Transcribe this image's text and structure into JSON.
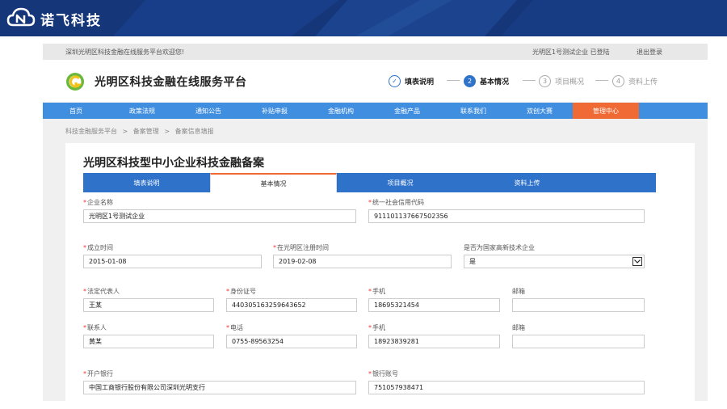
{
  "brand": {
    "name": "诺飞科技"
  },
  "welcome": {
    "text": "深圳光明区科技金融在线服务平台欢迎您!",
    "user": "光明区1号测试企业 已登陆",
    "logout": "退出登录"
  },
  "site": {
    "title": "光明区科技金融在线服务平台"
  },
  "steps": [
    {
      "number": "✓",
      "label": "填表说明"
    },
    {
      "number": "2",
      "label": "基本情况"
    },
    {
      "number": "3",
      "label": "项目概况"
    },
    {
      "number": "4",
      "label": "资料上传"
    }
  ],
  "nav": [
    "首页",
    "政策法规",
    "通知公告",
    "补贴申报",
    "金融机构",
    "金融产品",
    "联系我们",
    "双创大赛",
    "管理中心"
  ],
  "breadcrumb": [
    "科技金融服务平台",
    ">",
    "备案管理",
    ">",
    "备案信息填报"
  ],
  "form": {
    "title": "光明区科技型中小企业科技金融备案",
    "tabs": [
      "填表说明",
      "基本情况",
      "项目概况",
      "资料上传"
    ],
    "fields": {
      "company_name": {
        "label": "企业名称",
        "value": "光明区1号测试企业"
      },
      "credit_code": {
        "label": "统一社会信用代码",
        "value": "911101137667502356"
      },
      "founded": {
        "label": "成立时间",
        "value": "2015-01-08"
      },
      "registered": {
        "label": "在光明区注册时间",
        "value": "2019-02-08"
      },
      "hightech": {
        "label": "是否为国家高新技术企业",
        "value": "是"
      },
      "legal_rep": {
        "label": "法定代表人",
        "value": "王某"
      },
      "id_number": {
        "label": "身份证号",
        "value": "440305163259643652"
      },
      "legal_phone": {
        "label": "手机",
        "value": "18695321454"
      },
      "legal_email": {
        "label": "邮箱",
        "value": ""
      },
      "contact": {
        "label": "联系人",
        "value": "黄某"
      },
      "tel": {
        "label": "电话",
        "value": "0755-89563254"
      },
      "contact_phone": {
        "label": "手机",
        "value": "18923839281"
      },
      "contact_email": {
        "label": "邮箱",
        "value": ""
      },
      "bank": {
        "label": "开户银行",
        "value": "中国工商银行股份有限公司深圳光明支行"
      },
      "account": {
        "label": "银行账号",
        "value": "751057938471"
      }
    }
  },
  "colors": {
    "banner": "#16367a",
    "nav": "#3f8ee0",
    "nav_active": "#ef6a35",
    "tab": "#2f72c9",
    "required": "#ee3333"
  }
}
